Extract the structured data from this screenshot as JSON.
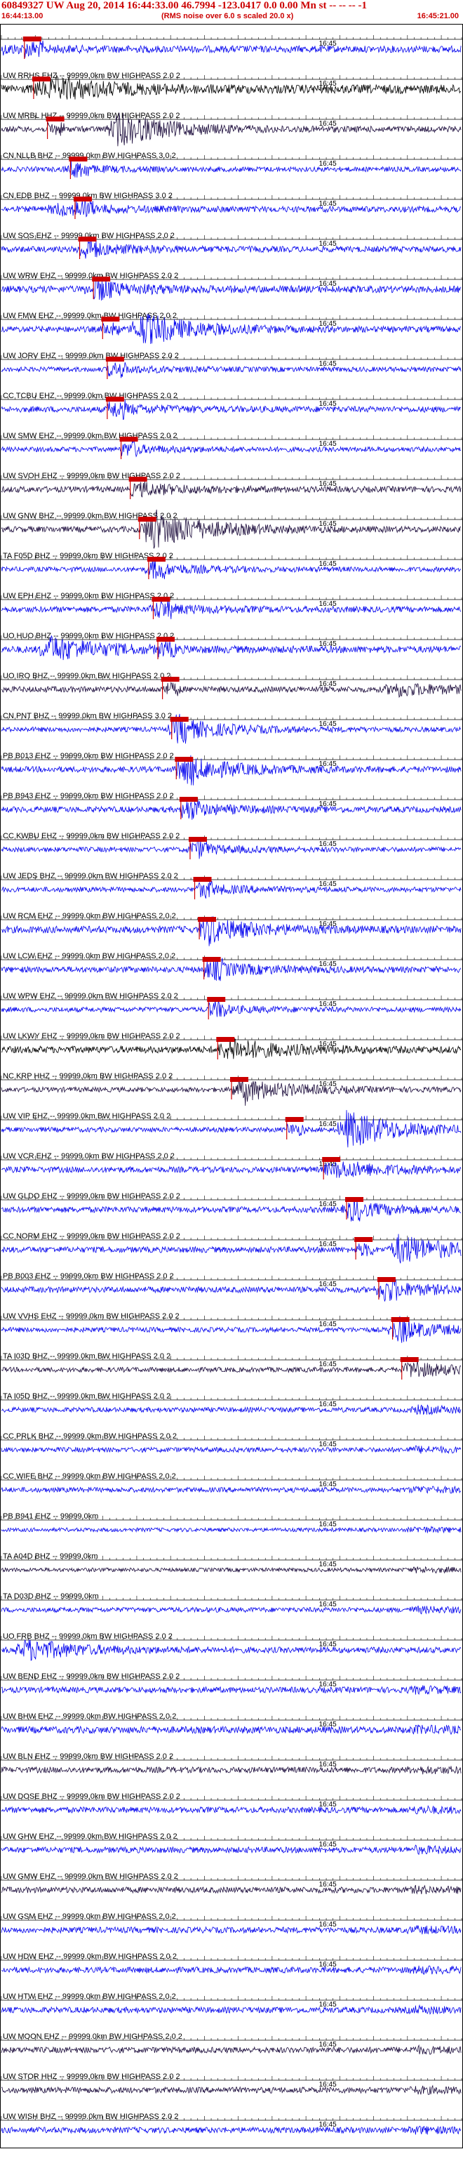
{
  "header": {
    "title": "60849327 UW Aug 20, 2014 16:44:33.00   46.7994 -123.0417  0.0 0.00 Mn st -- -- -- -1",
    "start_time": "16:44:13.00",
    "end_time": "16:45:21.00",
    "note": "(RMS noise over 6.0 s scaled 20.0 x)"
  },
  "colors": {
    "blue": "#0000ee",
    "dark": "#1a0a3a",
    "black": "#000000",
    "pick": "#cc0000",
    "axis": "#000000"
  },
  "chart_data": {
    "type": "seismogram-stack",
    "x_start": "16:44:13.00",
    "x_end": "16:45:21.00",
    "minute_tick_label": "16:45",
    "traces": [
      {
        "label": "",
        "color": "blue",
        "amp": 0.35,
        "burst_at": 0.0,
        "burst_amp": 0.3,
        "pick": 0.05
      },
      {
        "label": "UW RRHS EHZ -- 99999.0km BW  HIGHPASS  2.0  2",
        "color": "black",
        "amp": 0.45,
        "burst_at": 0.12,
        "burst_amp": 1.0,
        "pick": 0.07
      },
      {
        "label": "UW MRBL HHZ -- 99999.0km BW  HIGHPASS  2.0  2",
        "color": "dark",
        "amp": 0.3,
        "burst_at": 0.25,
        "burst_amp": 1.6,
        "pick": 0.1
      },
      {
        "label": "CN NLLB BHZ -- 99999.0km BW  HIGHPASS  3.0  2",
        "color": "blue",
        "amp": 0.25,
        "burst_at": 0.15,
        "burst_amp": 0.3,
        "pick": 0.15
      },
      {
        "label": "CN EDB BHZ -- 99999.0km BW  HIGHPASS  3.0  2",
        "color": "blue",
        "amp": 0.3,
        "burst_at": 0.12,
        "burst_amp": 0.5,
        "pick": 0.16
      },
      {
        "label": "UW SOS EHZ -- 99999.0km BW  HIGHPASS  2.0  2",
        "color": "blue",
        "amp": 0.3,
        "burst_at": 0.18,
        "burst_amp": 0.5,
        "pick": 0.17
      },
      {
        "label": "UW WRW EHZ -- 99999.0km BW  HIGHPASS  2.0  2",
        "color": "blue",
        "amp": 0.35,
        "burst_at": 0.2,
        "burst_amp": 0.6,
        "pick": 0.2
      },
      {
        "label": "UW FMW EHZ -- 99999.0km BW  HIGHPASS  2.0  2",
        "color": "blue",
        "amp": 0.3,
        "burst_at": 0.3,
        "burst_amp": 1.6,
        "pick": 0.22
      },
      {
        "label": "UW JORV EHZ -- 99999.0km BW  HIGHPASS  2.0  2",
        "color": "blue",
        "amp": 0.25,
        "burst_at": 0.25,
        "burst_amp": 0.3,
        "pick": 0.23
      },
      {
        "label": "CC TCBU EHZ -- 99999.0km BW  HIGHPASS  2.0  2",
        "color": "blue",
        "amp": 0.3,
        "burst_at": 0.25,
        "burst_amp": 0.4,
        "pick": 0.23
      },
      {
        "label": "UW SMW EHZ -- 99999.0km BW  HIGHPASS  2.0  2",
        "color": "blue",
        "amp": 0.25,
        "burst_at": 0.28,
        "burst_amp": 0.3,
        "pick": 0.26
      },
      {
        "label": "UW SVOH EHZ -- 99999.0km BW  HIGHPASS  2.0  2",
        "color": "dark",
        "amp": 0.3,
        "burst_at": 0.32,
        "burst_amp": 0.4,
        "pick": 0.28
      },
      {
        "label": "UW GNW BHZ -- 99999.0km BW  HIGHPASS  2.0  2",
        "color": "dark",
        "amp": 0.3,
        "burst_at": 0.33,
        "burst_amp": 1.8,
        "pick": 0.3
      },
      {
        "label": "TA F05D BHZ -- 99999.0km BW  HIGHPASS  2.0  2",
        "color": "blue",
        "amp": 0.25,
        "burst_at": 0.33,
        "burst_amp": 0.5,
        "pick": 0.32
      },
      {
        "label": "UW EPH EHZ -- 99999.0km BW  HIGHPASS  2.0  2",
        "color": "blue",
        "amp": 0.3,
        "burst_at": 0.34,
        "burst_amp": 0.4,
        "pick": 0.33
      },
      {
        "label": "UO HUO BHZ -- 99999.0km BW  HIGHPASS  2.0  2",
        "color": "blue",
        "amp": 0.35,
        "burst_at": 0.1,
        "burst_amp": 1.2,
        "pick": 0.34
      },
      {
        "label": "UO IRO BHZ -- 99999.0km BW  HIGHPASS  2.0  2",
        "color": "dark",
        "amp": 0.3,
        "burst_at": 0.85,
        "burst_amp": 0.6,
        "pick": 0.35
      },
      {
        "label": "CN PNT BHZ -- 99999.0km BW  HIGHPASS  3.0  2",
        "color": "blue",
        "amp": 0.25,
        "burst_at": 0.38,
        "burst_amp": 1.0,
        "pick": 0.37
      },
      {
        "label": "PB B013 EHZ -- 99999.0km BW  HIGHPASS  2.0  2",
        "color": "blue",
        "amp": 0.3,
        "burst_at": 0.4,
        "burst_amp": 1.1,
        "pick": 0.38
      },
      {
        "label": "PB B943 EHZ -- 99999.0km BW  HIGHPASS  2.0  2",
        "color": "blue",
        "amp": 0.3,
        "burst_at": 0.4,
        "burst_amp": 0.5,
        "pick": 0.39
      },
      {
        "label": "CC KWBU EHZ -- 99999.0km BW  HIGHPASS  2.0  2",
        "color": "blue",
        "amp": 0.25,
        "burst_at": 0.42,
        "burst_amp": 0.4,
        "pick": 0.41
      },
      {
        "label": "UW JEDS BHZ -- 99999.0km BW  HIGHPASS  2.0  2",
        "color": "blue",
        "amp": 0.25,
        "burst_at": 0.44,
        "burst_amp": 0.4,
        "pick": 0.42
      },
      {
        "label": "UW RCM EHZ -- 99999.0km BW  HIGHPASS  2.0  2",
        "color": "blue",
        "amp": 0.35,
        "burst_at": 0.45,
        "burst_amp": 1.0,
        "pick": 0.43
      },
      {
        "label": "UW LCW EHZ -- 99999.0km BW  HIGHPASS  2.0  2",
        "color": "blue",
        "amp": 0.3,
        "burst_at": 0.46,
        "burst_amp": 0.6,
        "pick": 0.44
      },
      {
        "label": "UW WPW EHZ -- 99999.0km BW  HIGHPASS  2.0  2",
        "color": "blue",
        "amp": 0.25,
        "burst_at": 0.46,
        "burst_amp": 0.3,
        "pick": 0.45
      },
      {
        "label": "UW LKWY EHZ -- 99999.0km BW  HIGHPASS  2.0  2",
        "color": "black",
        "amp": 0.35,
        "burst_at": 0.5,
        "burst_amp": 0.9,
        "pick": 0.47
      },
      {
        "label": "NC KRP HHZ -- 99999.0km BW  HIGHPASS  2.0  2",
        "color": "dark",
        "amp": 0.25,
        "burst_at": 0.53,
        "burst_amp": 1.0,
        "pick": 0.5
      },
      {
        "label": "UW VIP EHZ -- 99999.0km BW  HIGHPASS  2.0  2",
        "color": "blue",
        "amp": 0.25,
        "burst_at": 0.75,
        "burst_amp": 1.8,
        "pick": 0.62
      },
      {
        "label": "UW VCR EHZ -- 99999.0km BW  HIGHPASS  2.0  2",
        "color": "blue",
        "amp": 0.3,
        "burst_at": 0.74,
        "burst_amp": 0.7,
        "pick": 0.7
      },
      {
        "label": "UW GLDO EHZ -- 99999.0km BW  HIGHPASS  2.0  2",
        "color": "blue",
        "amp": 0.3,
        "burst_at": 0.76,
        "burst_amp": 0.6,
        "pick": 0.75
      },
      {
        "label": "CC NORM EHZ -- 99999.0km BW  HIGHPASS  2.0  2",
        "color": "blue",
        "amp": 0.3,
        "burst_at": 0.86,
        "burst_amp": 1.4,
        "pick": 0.77
      },
      {
        "label": "PB B003 EHZ -- 99999.0km BW  HIGHPASS  2.0  2",
        "color": "blue",
        "amp": 0.3,
        "burst_at": 0.83,
        "burst_amp": 0.7,
        "pick": 0.82
      },
      {
        "label": "UW VVHS EHZ -- 99999.0km BW  HIGHPASS  2.0  2",
        "color": "blue",
        "amp": 0.25,
        "burst_at": 0.86,
        "burst_amp": 0.8,
        "pick": 0.85
      },
      {
        "label": "TA I03D BHZ -- 99999.0km BW  HIGHPASS  2.0  2",
        "color": "dark",
        "amp": 0.25,
        "burst_at": 0.9,
        "burst_amp": 0.6,
        "pick": 0.87
      },
      {
        "label": "TA I05D BHZ -- 99999.0km BW  HIGHPASS  2.0  2",
        "color": "blue",
        "amp": 0.25,
        "burst_at": 0.9,
        "burst_amp": 0.3,
        "pick": null
      },
      {
        "label": "CC PRLK BHZ -- 99999.0km BW  HIGHPASS  2.0  2",
        "color": "blue",
        "amp": 0.25,
        "burst_at": 0.9,
        "burst_amp": 0.2,
        "pick": null
      },
      {
        "label": "CC WIFE BHZ -- 99999.0km BW  HIGHPASS  2.0  2",
        "color": "blue",
        "amp": 0.25,
        "burst_at": 0.9,
        "burst_amp": 0.2,
        "pick": null
      },
      {
        "label": "PB B941 EHZ -- 99999.0km",
        "color": "blue",
        "amp": 0.2,
        "burst_at": 0.9,
        "burst_amp": 0.2,
        "pick": null
      },
      {
        "label": "TA A04D BHZ -- 99999.0km",
        "color": "dark",
        "amp": 0.2,
        "burst_at": 0.9,
        "burst_amp": 0.2,
        "pick": null
      },
      {
        "label": "TA D03D BHZ -- 99999.0km",
        "color": "blue",
        "amp": 0.25,
        "burst_at": 0.9,
        "burst_amp": 0.2,
        "pick": null
      },
      {
        "label": "UO FRB BHZ -- 99999.0km BW  HIGHPASS  2.0  2",
        "color": "blue",
        "amp": 0.3,
        "burst_at": 0.05,
        "burst_amp": 1.0,
        "pick": null
      },
      {
        "label": "UW BEND EHZ -- 99999.0km BW  HIGHPASS  2.0  2",
        "color": "blue",
        "amp": 0.3,
        "burst_at": 0.9,
        "burst_amp": 0.2,
        "pick": null
      },
      {
        "label": "UW BHW EHZ -- 99999.0km BW  HIGHPASS  2.0  2",
        "color": "blue",
        "amp": 0.35,
        "burst_at": 0.9,
        "burst_amp": 0.2,
        "pick": null
      },
      {
        "label": "UW BLN EHZ -- 99999.0km BW  HIGHPASS  2.0  2",
        "color": "dark",
        "amp": 0.3,
        "burst_at": 0.9,
        "burst_amp": 0.2,
        "pick": null
      },
      {
        "label": "UW DOSE BHZ -- 99999.0km BW  HIGHPASS  2.0  2",
        "color": "blue",
        "amp": 0.3,
        "burst_at": 0.9,
        "burst_amp": 0.2,
        "pick": null
      },
      {
        "label": "UW GHW EHZ -- 99999.0km BW  HIGHPASS  2.0  2",
        "color": "blue",
        "amp": 0.3,
        "burst_at": 0.9,
        "burst_amp": 0.2,
        "pick": null
      },
      {
        "label": "UW GMW EHZ -- 99999.0km BW  HIGHPASS  2.0  2",
        "color": "dark",
        "amp": 0.3,
        "burst_at": 0.9,
        "burst_amp": 0.2,
        "pick": null
      },
      {
        "label": "UW GSM EHZ -- 99999.0km BW  HIGHPASS  2.0  2",
        "color": "blue",
        "amp": 0.3,
        "burst_at": 0.9,
        "burst_amp": 0.2,
        "pick": null
      },
      {
        "label": "UW HDW EHZ -- 99999.0km BW  HIGHPASS  2.0  2",
        "color": "blue",
        "amp": 0.3,
        "burst_at": 0.9,
        "burst_amp": 0.2,
        "pick": null
      },
      {
        "label": "UW HTW EHZ -- 99999.0km BW  HIGHPASS  2.0  2",
        "color": "blue",
        "amp": 0.3,
        "burst_at": 0.9,
        "burst_amp": 0.2,
        "pick": null
      },
      {
        "label": "UW MOON EHZ -- 99999.0km BW  HIGHPASS  2.0  2",
        "color": "dark",
        "amp": 0.3,
        "burst_at": 0.9,
        "burst_amp": 0.2,
        "pick": null
      },
      {
        "label": "UW STOR HHZ -- 99999.0km BW  HIGHPASS  2.0  2",
        "color": "dark",
        "amp": 0.3,
        "burst_at": 0.9,
        "burst_amp": 0.2,
        "pick": null
      },
      {
        "label": "UW WISH BHZ -- 99999.0km BW  HIGHPASS  2.0  2",
        "color": "blue",
        "amp": 0.3,
        "burst_at": 0.9,
        "burst_amp": 0.2,
        "pick": null
      }
    ]
  }
}
